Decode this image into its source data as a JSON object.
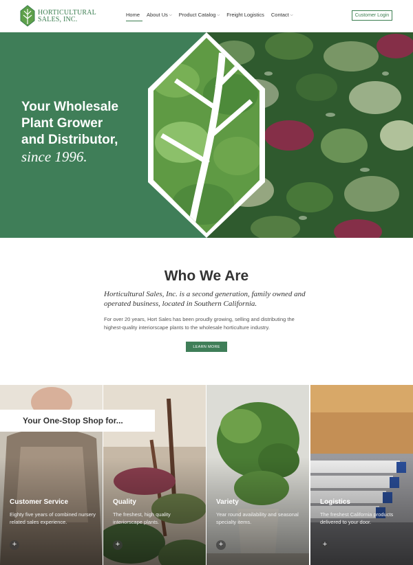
{
  "header": {
    "logo_line1": "HORTICULTURAL",
    "logo_line2": "SALES, INC.",
    "nav": [
      {
        "label": "Home",
        "active": true,
        "dropdown": false
      },
      {
        "label": "About Us",
        "active": false,
        "dropdown": true
      },
      {
        "label": "Product Catalog",
        "active": false,
        "dropdown": true
      },
      {
        "label": "Freight Logistics",
        "active": false,
        "dropdown": false
      },
      {
        "label": "Contact",
        "active": false,
        "dropdown": true
      }
    ],
    "login_label": "Customer Login"
  },
  "hero": {
    "line1": "Your Wholesale",
    "line2": "Plant Grower",
    "line3": "and Distributor,",
    "since": "since 1996."
  },
  "who": {
    "title": "Who We Are",
    "lead": "Horticultural Sales, Inc. is a second generation, family owned and operated business, located in Southern California.",
    "body": "For over 20 years, Hort Sales has been proudly growing, selling and distributing the highest-quality interiorscape plants to the wholesale horticulture industry.",
    "button": "LEARN MORE"
  },
  "cards": {
    "banner": "Your One-Stop Shop for...",
    "items": [
      {
        "title": "Customer Service",
        "desc": "Eighty five years of combined nursery related sales experience.",
        "plus": "+"
      },
      {
        "title": "Quality",
        "desc": "The freshest, high quality interiorscape plants.",
        "plus": "+"
      },
      {
        "title": "Variety",
        "desc": "Year round availability and seasonal specialty items.",
        "plus": "+"
      },
      {
        "title": "Logistics",
        "desc": "The freshest California products delivered to your door.",
        "plus": "+"
      }
    ]
  },
  "colors": {
    "brand_green": "#3f7e58",
    "white": "#ffffff"
  }
}
